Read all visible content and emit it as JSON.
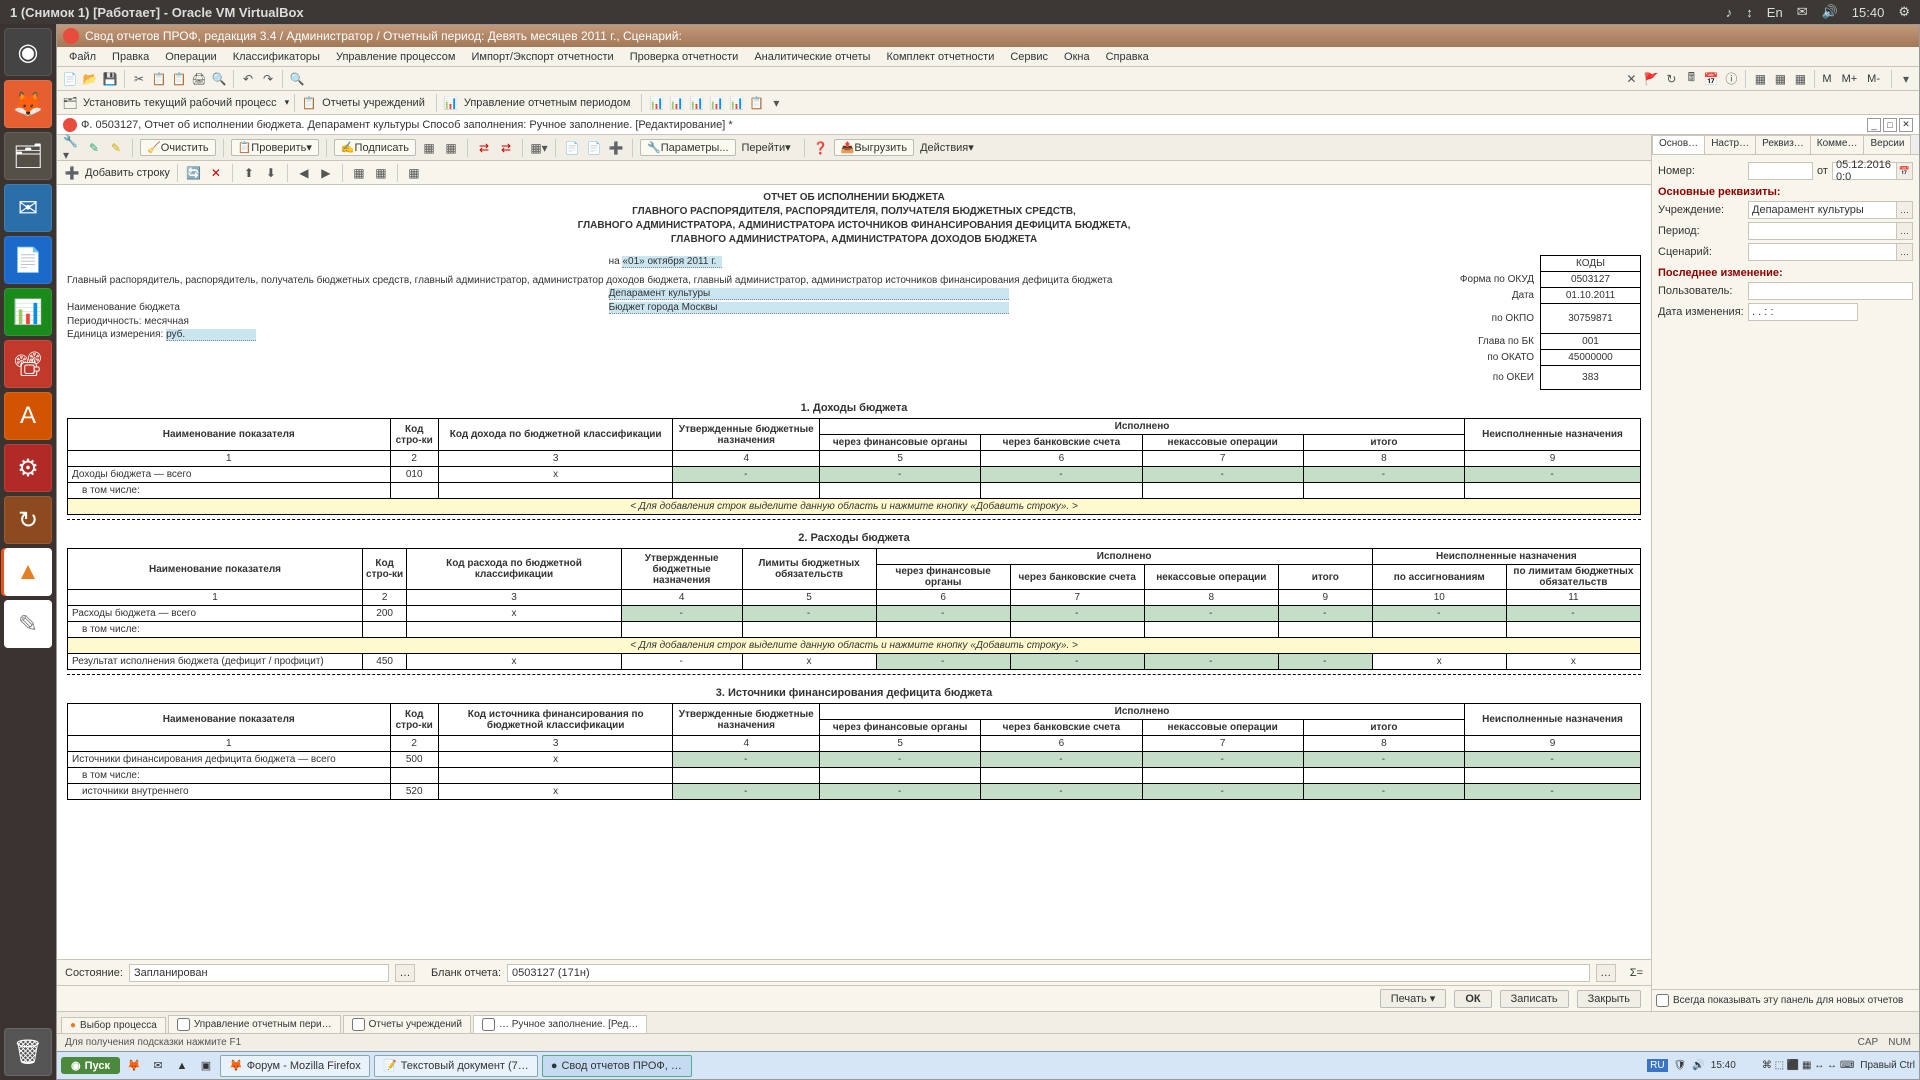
{
  "ubuntu": {
    "title": "1 (Снимок 1) [Работает] - Oracle VM VirtualBox",
    "time": "15:40",
    "lang": "En"
  },
  "win": {
    "title": "Свод отчетов ПРОФ, редакция 3.4 / Администратор / Отчетный период: Девять месяцев 2011 г., Сценарий:"
  },
  "menu": {
    "file": "Файл",
    "edit": "Правка",
    "ops": "Операции",
    "cls": "Классификаторы",
    "proc": "Управление процессом",
    "imp": "Импорт/Экспорт отчетности",
    "check": "Проверка отчетности",
    "anal": "Аналитические отчеты",
    "comp": "Комплект отчетности",
    "svc": "Сервис",
    "win": "Окна",
    "help": "Справка"
  },
  "tb2": {
    "setproc": "Установить текущий рабочий процесс",
    "reports": "Отчеты учреждений",
    "period": "Управление отчетным периодом"
  },
  "doctab": {
    "title": "Ф. 0503127, Отчет об исполнении бюджета. Депарамент культуры Способ заполнения: Ручное заполнение. [Редактирование] *"
  },
  "tb3": {
    "clear": "Очистить",
    "check": "Проверить",
    "sign": "Подписать",
    "params": "Параметры...",
    "go": "Перейти",
    "upload": "Выгрузить",
    "actions": "Действия"
  },
  "addrow": {
    "label": "Добавить строку"
  },
  "report": {
    "title1": "ОТЧЕТ ОБ ИСПОЛНЕНИИ БЮДЖЕТА",
    "title2": "ГЛАВНОГО РАСПОРЯДИТЕЛЯ, РАСПОРЯДИТЕЛЯ, ПОЛУЧАТЕЛЯ БЮДЖЕТНЫХ СРЕДСТВ,",
    "title3": "ГЛАВНОГО АДМИНИСТРАТОРА, АДМИНИСТРАТОРА ИСТОЧНИКОВ ФИНАНСИРОВАНИЯ ДЕФИЦИТА БЮДЖЕТА,",
    "title4": "ГЛАВНОГО АДМИНИСТРАТОРА, АДМИНИСТРАТОРА ДОХОДОВ БЮДЖЕТА",
    "na_date_lbl": "на",
    "na_date": "«01» октября 2011 г.",
    "gr_lbl": "Главный распорядитель, распорядитель, получатель бюджетных средств, главный администратор, администратор доходов бюджета, главный администратор, администратор источников финансирования дефицита бюджета",
    "dep": "Депарамент культуры",
    "budget_lbl": "Наименование бюджета",
    "budget": "Бюджет города Москвы",
    "period_lbl": "Периодичность: месячная",
    "unit_lbl": "Единица измерения:",
    "unit": "руб.",
    "codes_hdr": "КОДЫ",
    "okud_lbl": "Форма по ОКУД",
    "okud": "0503127",
    "date_lbl": "Дата",
    "date": "01.10.2011",
    "okpo_lbl": "по ОКПО",
    "okpo": "30759871",
    "glava_lbl": "Глава по БК",
    "glava": "001",
    "okato_lbl": "по ОКАТО",
    "okato": "45000000",
    "okei_lbl": "по ОКЕИ",
    "okei": "383"
  },
  "sec1": {
    "title": "1. Доходы бюджета",
    "h_name": "Наименование показателя",
    "h_code": "Код стро-ки",
    "h_inc": "Код дохода по бюджетной классификации",
    "h_appr": "Утвержденные бюджетные назначения",
    "h_exec": "Исполнено",
    "h_fin": "через финансовые органы",
    "h_bank": "через банковские счета",
    "h_nek": "некассовые операции",
    "h_total": "итого",
    "h_unex": "Неисполненные назначения",
    "row1": "Доходы бюджета — всего",
    "code1": "010",
    "x": "х",
    "row2": "в том числе:",
    "addhint": "< Для добавления строк выделите данную область и нажмите кнопку «Добавить строку». >"
  },
  "sec2": {
    "title": "2. Расходы бюджета",
    "h_exp": "Код расхода по бюджетной классификации",
    "h_lim": "Лимиты бюджетных обязательств",
    "h_unex2": "Неисполненные назначения",
    "h_assig": "по ассигнованиям",
    "h_limits": "по лимитам бюджетных обязательств",
    "row1": "Расходы бюджета — всего",
    "code1": "200",
    "row3": "Результат исполнения бюджета (дефицит / профицит)",
    "code3": "450"
  },
  "sec3": {
    "title": "3. Источники финансирования дефицита бюджета",
    "h_src": "Код источника финансирования по бюджетной классификации",
    "row1": "Источники финансирования дефицита бюджета — всего",
    "code1": "500",
    "row2": "в том числе:",
    "row3": "источники внутреннего",
    "code3": "520"
  },
  "status": {
    "lbl": "Состояние:",
    "val": "Запланирован",
    "blank_lbl": "Бланк отчета:",
    "blank": "0503127 (171н)",
    "sigma": "Σ="
  },
  "printbar": {
    "print": "Печать",
    "ok": "ОК",
    "save": "Записать",
    "close": "Закрыть"
  },
  "wtabs": {
    "t1": "Выбор процесса",
    "t2": "Управление отчетным пери…",
    "t3": "Отчеты учреждений",
    "t4": "… Ручное заполнение. [Ред…"
  },
  "statusbar": {
    "hint": "Для получения подсказки нажмите F1",
    "cap": "CAP",
    "num": "NUM"
  },
  "rp": {
    "tab1": "Основ…",
    "tab2": "Настр…",
    "tab3": "Реквиз…",
    "tab4": "Комме…",
    "tab5": "Версии",
    "num_lbl": "Номер:",
    "ot": "от",
    "date": "05.12.2016  0:0",
    "sec1": "Основные реквизиты:",
    "org_lbl": "Учреждение:",
    "org": "Депарамент культуры",
    "per_lbl": "Период:",
    "per": "Девять месяцев 2011 г.",
    "scen_lbl": "Сценарий:",
    "sec2": "Последнее изменение:",
    "user_lbl": "Пользователь:",
    "chg_lbl": "Дата изменения:",
    "chg": "  .  .       :  :",
    "footer": "Всегда показывать эту панель для новых отчетов"
  },
  "taskbar": {
    "start": "Пуск",
    "t1": "Форум - Mozilla Firefox",
    "t2": "Текстовый документ (7…",
    "t3": "Свод отчетов ПРОФ, …",
    "lang": "RU",
    "time": "15:40",
    "ctrl": "Правый Ctrl"
  }
}
